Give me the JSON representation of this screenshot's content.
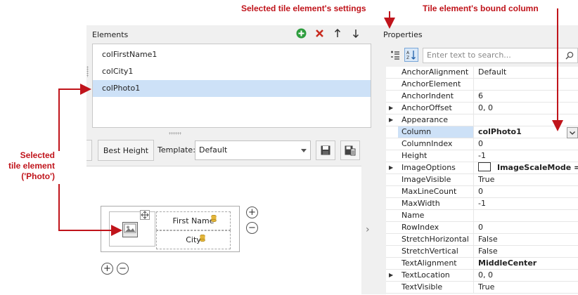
{
  "callouts": {
    "settings": "Selected tile element's settings",
    "bound_column": "Tile element's bound column",
    "selected_tile": [
      "Selected",
      "tile element",
      "('Photo')"
    ]
  },
  "elements_panel": {
    "title": "Elements",
    "items": [
      {
        "label": "colFirstName1",
        "selected": false
      },
      {
        "label": "colCity1",
        "selected": false
      },
      {
        "label": "colPhoto1",
        "selected": true
      }
    ],
    "icons": [
      "add-icon",
      "remove-icon",
      "move-up-icon",
      "move-down-icon"
    ]
  },
  "toolbar": {
    "best_height_label": "Best Height",
    "template_label": "Template:",
    "template_value": "Default"
  },
  "tile": {
    "first_name_label": "First Name",
    "city_label": "City"
  },
  "properties_panel": {
    "title": "Properties",
    "search_placeholder": "Enter text to search...",
    "rows": [
      {
        "name": "AnchorAlignment",
        "value": "Default",
        "expandable": false,
        "bold": false,
        "selected": false
      },
      {
        "name": "AnchorElement",
        "value": "",
        "expandable": false,
        "bold": false,
        "selected": false
      },
      {
        "name": "AnchorIndent",
        "value": "6",
        "expandable": false,
        "bold": false,
        "selected": false
      },
      {
        "name": "AnchorOffset",
        "value": "0, 0",
        "expandable": true,
        "bold": false,
        "selected": false
      },
      {
        "name": "Appearance",
        "value": "",
        "expandable": true,
        "bold": false,
        "selected": false
      },
      {
        "name": "Column",
        "value": "colPhoto1",
        "expandable": false,
        "bold": true,
        "selected": true
      },
      {
        "name": "ColumnIndex",
        "value": "0",
        "expandable": false,
        "bold": false,
        "selected": false
      },
      {
        "name": "Height",
        "value": "-1",
        "expandable": false,
        "bold": false,
        "selected": false
      },
      {
        "name": "ImageOptions",
        "value": "ImageScaleMode = S",
        "expandable": true,
        "bold": true,
        "selected": false
      },
      {
        "name": "ImageVisible",
        "value": "True",
        "expandable": false,
        "bold": false,
        "selected": false
      },
      {
        "name": "MaxLineCount",
        "value": "0",
        "expandable": false,
        "bold": false,
        "selected": false
      },
      {
        "name": "MaxWidth",
        "value": "-1",
        "expandable": false,
        "bold": false,
        "selected": false
      },
      {
        "name": "Name",
        "value": "",
        "expandable": false,
        "bold": false,
        "selected": false
      },
      {
        "name": "RowIndex",
        "value": "0",
        "expandable": false,
        "bold": false,
        "selected": false
      },
      {
        "name": "StretchHorizontal",
        "value": "False",
        "expandable": false,
        "bold": false,
        "selected": false
      },
      {
        "name": "StretchVertical",
        "value": "False",
        "expandable": false,
        "bold": false,
        "selected": false
      },
      {
        "name": "TextAlignment",
        "value": "MiddleCenter",
        "expandable": false,
        "bold": true,
        "selected": false
      },
      {
        "name": "TextLocation",
        "value": "0, 0",
        "expandable": true,
        "bold": false,
        "selected": false
      },
      {
        "name": "TextVisible",
        "value": "True",
        "expandable": false,
        "bold": false,
        "selected": false
      }
    ]
  },
  "colors": {
    "callout": "#c0141b",
    "selection": "#cde1f7",
    "add_icon": "#2e9d3e",
    "remove_icon": "#c82a1e"
  }
}
